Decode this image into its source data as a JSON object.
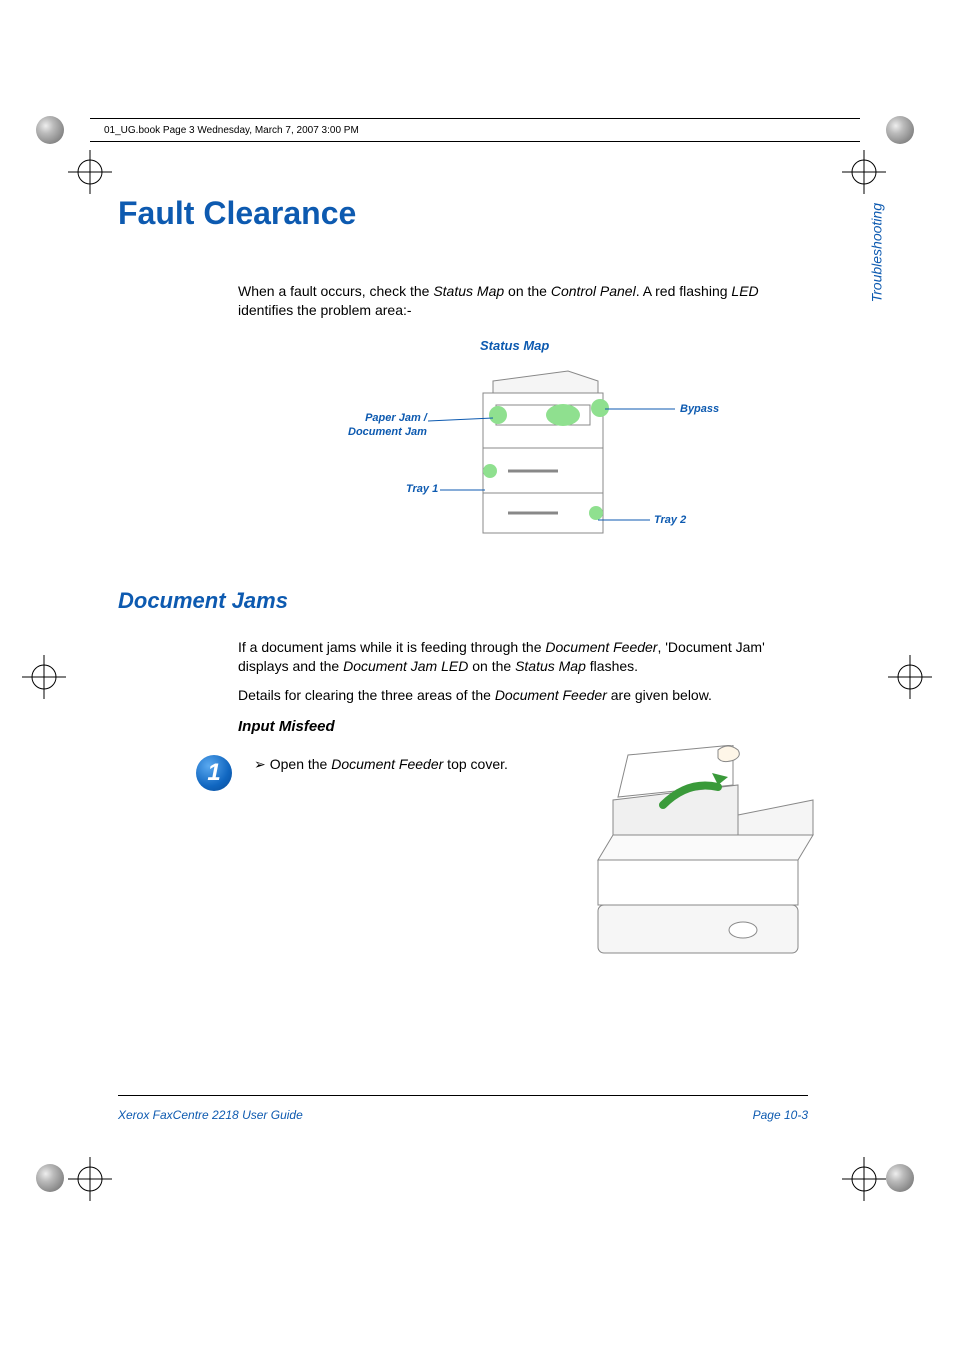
{
  "header_stamp": "01_UG.book  Page 3  Wednesday, March 7, 2007  3:00 PM",
  "side_tab": "Troubleshooting",
  "title": "Fault Clearance",
  "intro": {
    "pre1": "When a fault occurs, check the ",
    "it1": "Status Map",
    "mid1": " on the ",
    "it2": "Control Panel",
    "mid2": ". A red flashing ",
    "it3": "LED",
    "post": " identifies the problem area:-"
  },
  "status_map": {
    "title": "Status Map",
    "paper_jam_l1": "Paper Jam /",
    "paper_jam_l2": "Document Jam",
    "tray1": "Tray 1",
    "bypass": "Bypass",
    "tray2": "Tray 2"
  },
  "section_title": "Document Jams",
  "p2": {
    "a": "If a document jams while it is feeding through the ",
    "it1": "Document Feeder",
    "b": ", 'Document Jam' displays and the ",
    "it2": "Document Jam LED",
    "c": " on the ",
    "it3": "Status Map",
    "d": " flashes."
  },
  "p3": {
    "a": "Details for clearing the three areas of the ",
    "it1": "Document Feeder",
    "b": " are given below."
  },
  "sub_title": "Input Misfeed",
  "step": {
    "num": "1",
    "arr": "➢",
    "a": "Open the ",
    "it1": "Document Feeder",
    "b": " top cover."
  },
  "footer": {
    "left": "Xerox FaxCentre 2218 User Guide",
    "right": "Page 10-3"
  }
}
